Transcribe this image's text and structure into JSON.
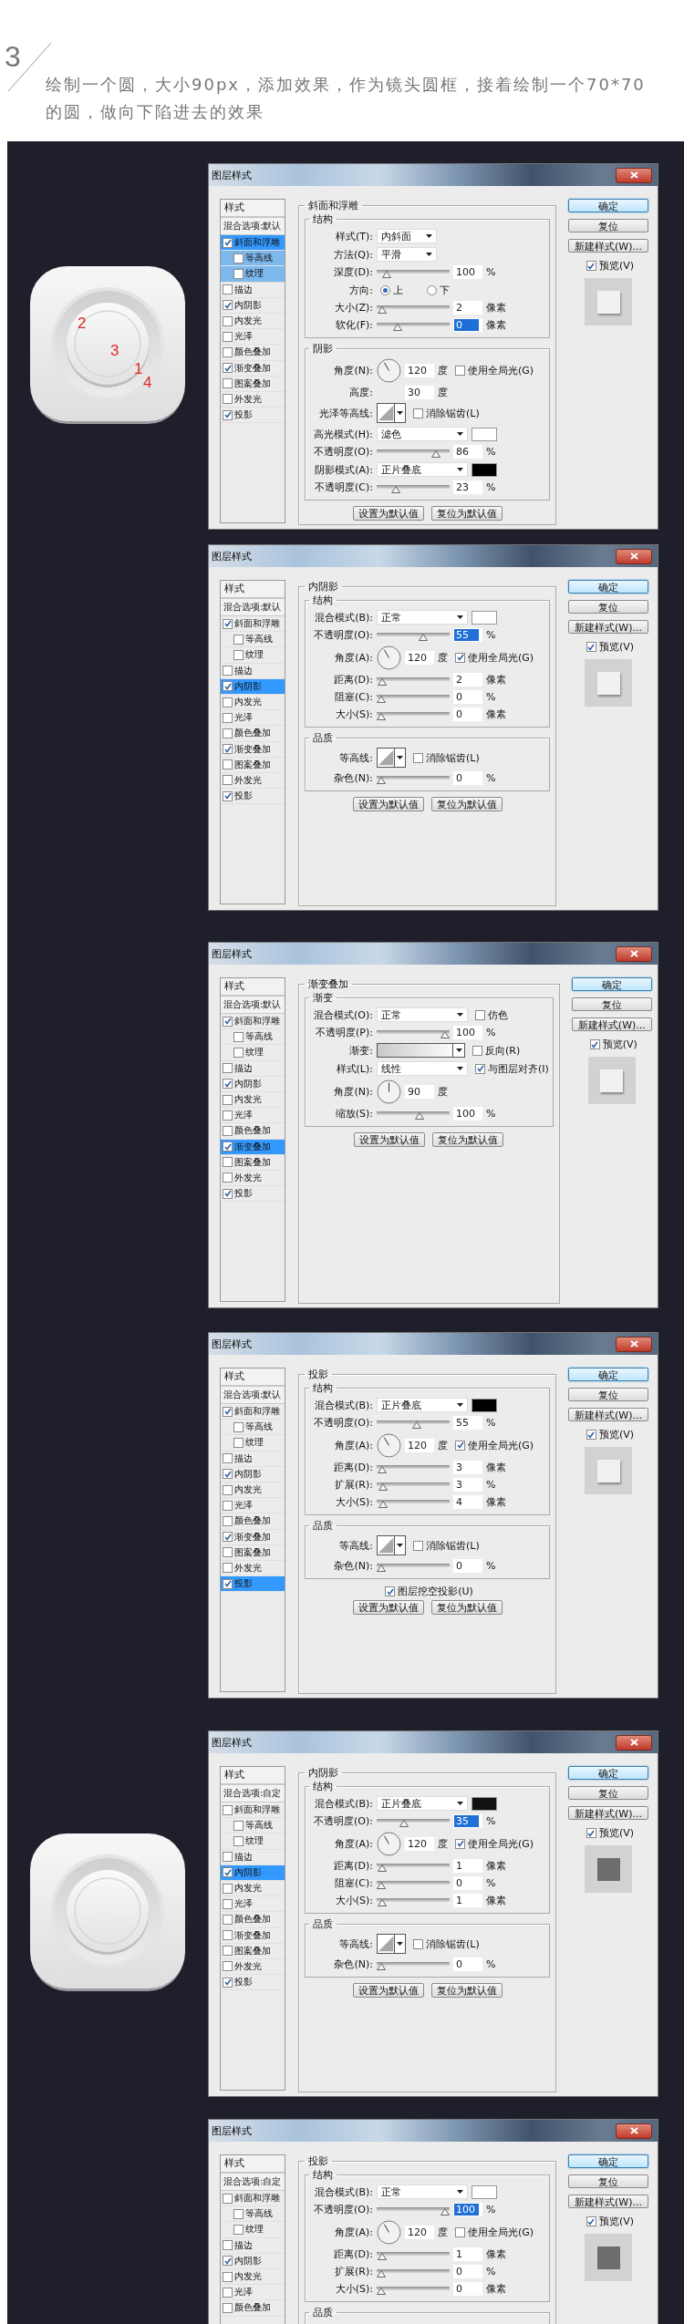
{
  "step": "3",
  "intro": "绘制一个圆，大小90px，添加效果，作为镜头圆框，接着绘制一个70*70的圆，做向下陷进去的效果",
  "dialogs": [
    {
      "title": "图层样式",
      "artwork": {
        "kind": "app-icon",
        "annotations": [
          "2",
          "3",
          "1",
          "4"
        ]
      },
      "styles_header": "样式",
      "blend_options": "混合选项:默认",
      "style_items": [
        {
          "label": "斜面和浮雕",
          "checked": true,
          "selected": true,
          "children": [
            {
              "label": "等高线",
              "checked": false,
              "selected": false
            },
            {
              "label": "纹理",
              "checked": false,
              "selected": false
            }
          ]
        },
        {
          "label": "描边",
          "checked": false,
          "selected": false
        },
        {
          "label": "内阴影",
          "checked": true,
          "selected": false
        },
        {
          "label": "内发光",
          "checked": false,
          "selected": false
        },
        {
          "label": "光泽",
          "checked": false,
          "selected": false
        },
        {
          "label": "颜色叠加",
          "checked": false,
          "selected": false
        },
        {
          "label": "渐变叠加",
          "checked": true,
          "selected": false
        },
        {
          "label": "图案叠加",
          "checked": false,
          "selected": false
        },
        {
          "label": "外发光",
          "checked": false,
          "selected": false
        },
        {
          "label": "投影",
          "checked": true,
          "selected": false
        }
      ],
      "panel_title": "斜面和浮雕",
      "groups": [
        {
          "title": "结构",
          "rows": [
            {
              "kind": "dropdown",
              "label": "样式(T):",
              "value": "内斜面"
            },
            {
              "kind": "dropdown",
              "label": "方法(Q):",
              "value": "平滑"
            },
            {
              "kind": "slider",
              "label": "深度(D):",
              "level": 0.09,
              "value": "100",
              "unit": "%",
              "highlighted": false
            },
            {
              "kind": "radio",
              "label": "方向:",
              "options": [
                {
                  "label": "上",
                  "selected": true
                },
                {
                  "label": "下",
                  "selected": false
                }
              ]
            },
            {
              "kind": "slider",
              "label": "大小(Z):",
              "level": 0.02,
              "value": "2",
              "unit": "像素",
              "highlighted": false
            },
            {
              "kind": "slider",
              "label": "软化(F):",
              "level": 0.26,
              "value": "0",
              "unit": "像素",
              "highlighted": true
            }
          ]
        },
        {
          "title": "阴影",
          "rows": [
            {
              "kind": "angle",
              "label": "角度(N):",
              "value": "120",
              "unit": "度",
              "checkbox": {
                "label": "使用全局光(G)",
                "checked": false
              }
            },
            {
              "kind": "number",
              "label": "高度:",
              "value": "30",
              "unit": "度"
            },
            {
              "kind": "contour",
              "label": "光泽等高线:",
              "checkbox": {
                "label": "消除锯齿(L)",
                "checked": false
              }
            },
            {
              "kind": "dropdown",
              "label": "高光模式(H):",
              "value": "滤色",
              "color": "#ffffff"
            },
            {
              "kind": "slider",
              "label": "不透明度(O):",
              "level": 0.85,
              "value": "86",
              "unit": "%",
              "highlighted": false
            },
            {
              "kind": "dropdown",
              "label": "阴影模式(A):",
              "value": "正片叠底",
              "color": "#000000"
            },
            {
              "kind": "slider",
              "label": "不透明度(C):",
              "level": 0.23,
              "value": "23",
              "unit": "%",
              "highlighted": false
            }
          ]
        }
      ],
      "defaults_buttons": [
        "设置为默认值",
        "复位为默认值"
      ],
      "actions": [
        {
          "label": "确定",
          "default": true
        },
        {
          "label": "复位",
          "default": false
        },
        {
          "label": "新建样式(W)...",
          "default": false
        }
      ],
      "preview": {
        "label": "预览(V)",
        "checked": true,
        "kind": "light"
      }
    },
    {
      "title": "图层样式",
      "styles_header": "样式",
      "blend_options": "混合选项:默认",
      "style_items": [
        {
          "label": "斜面和浮雕",
          "checked": true,
          "selected": false,
          "children": [
            {
              "label": "等高线",
              "checked": false,
              "selected": false
            },
            {
              "label": "纹理",
              "checked": false,
              "selected": false
            }
          ]
        },
        {
          "label": "描边",
          "checked": false,
          "selected": false
        },
        {
          "label": "内阴影",
          "checked": true,
          "selected": true
        },
        {
          "label": "内发光",
          "checked": false,
          "selected": false
        },
        {
          "label": "光泽",
          "checked": false,
          "selected": false
        },
        {
          "label": "颜色叠加",
          "checked": false,
          "selected": false
        },
        {
          "label": "渐变叠加",
          "checked": true,
          "selected": false
        },
        {
          "label": "图案叠加",
          "checked": false,
          "selected": false
        },
        {
          "label": "外发光",
          "checked": false,
          "selected": false
        },
        {
          "label": "投影",
          "checked": true,
          "selected": false
        }
      ],
      "panel_title": "内阴影",
      "groups": [
        {
          "title": "结构",
          "rows": [
            {
              "kind": "dropdown",
              "label": "混合模式(B):",
              "value": "正常",
              "color": "#ffffff"
            },
            {
              "kind": "slider",
              "label": "不透明度(O):",
              "level": 0.66,
              "value": "55",
              "unit": "%",
              "highlighted": true
            },
            {
              "kind": "angle",
              "label": "角度(A):",
              "value": "120",
              "unit": "度",
              "checkbox": {
                "label": "使用全局光(G)",
                "checked": true
              }
            },
            {
              "kind": "slider",
              "label": "距离(D):",
              "level": 0.02,
              "value": "2",
              "unit": "像素",
              "highlighted": false
            },
            {
              "kind": "slider",
              "label": "阻塞(C):",
              "level": 0,
              "value": "0",
              "unit": "%",
              "highlighted": false
            },
            {
              "kind": "slider",
              "label": "大小(S):",
              "level": 0,
              "value": "0",
              "unit": "像素",
              "highlighted": false
            }
          ]
        },
        {
          "title": "品质",
          "rows": [
            {
              "kind": "contour",
              "label": "等高线:",
              "checkbox": {
                "label": "消除锯齿(L)",
                "checked": false
              }
            },
            {
              "kind": "slider",
              "label": "杂色(N):",
              "level": 0,
              "value": "0",
              "unit": "%",
              "highlighted": false
            }
          ]
        }
      ],
      "defaults_buttons": [
        "设置为默认值",
        "复位为默认值"
      ],
      "actions": [
        {
          "label": "确定",
          "default": true
        },
        {
          "label": "复位",
          "default": false
        },
        {
          "label": "新建样式(W)...",
          "default": false
        }
      ],
      "preview": {
        "label": "预览(V)",
        "checked": true,
        "kind": "light"
      }
    },
    {
      "title": "图层样式",
      "styles_header": "样式",
      "blend_options": "混合选项:默认",
      "style_items": [
        {
          "label": "斜面和浮雕",
          "checked": true,
          "selected": false,
          "children": [
            {
              "label": "等高线",
              "checked": false,
              "selected": false
            },
            {
              "label": "纹理",
              "checked": false,
              "selected": false
            }
          ]
        },
        {
          "label": "描边",
          "checked": false,
          "selected": false
        },
        {
          "label": "内阴影",
          "checked": true,
          "selected": false
        },
        {
          "label": "内发光",
          "checked": false,
          "selected": false
        },
        {
          "label": "光泽",
          "checked": false,
          "selected": false
        },
        {
          "label": "颜色叠加",
          "checked": false,
          "selected": false
        },
        {
          "label": "渐变叠加",
          "checked": true,
          "selected": true
        },
        {
          "label": "图案叠加",
          "checked": false,
          "selected": false
        },
        {
          "label": "外发光",
          "checked": false,
          "selected": false
        },
        {
          "label": "投影",
          "checked": true,
          "selected": false
        }
      ],
      "panel_title": "渐变叠加",
      "groups": [
        {
          "title": "渐变",
          "rows": [
            {
              "kind": "dropdown",
              "label": "混合模式(O):",
              "value": "正常",
              "checkbox": {
                "label": "仿色",
                "checked": false
              }
            },
            {
              "kind": "slider",
              "label": "不透明度(P):",
              "level": 1,
              "value": "100",
              "unit": "%",
              "highlighted": false
            },
            {
              "kind": "gradient",
              "label": "渐变:",
              "checkbox": {
                "label": "反向(R)",
                "checked": false
              }
            },
            {
              "kind": "dropdown",
              "label": "样式(L):",
              "value": "线性",
              "checkbox": {
                "label": "与图层对齐(I)",
                "checked": true
              }
            },
            {
              "kind": "angle",
              "label": "角度(N):",
              "value": "90",
              "unit": "度"
            },
            {
              "kind": "slider",
              "label": "缩放(S):",
              "level": 0.6,
              "value": "100",
              "unit": "%",
              "highlighted": false
            }
          ]
        }
      ],
      "defaults_buttons": [
        "设置为默认值",
        "复位为默认值"
      ],
      "actions": [
        {
          "label": "确定",
          "default": true
        },
        {
          "label": "复位",
          "default": false
        },
        {
          "label": "新建样式(W)...",
          "default": false
        }
      ],
      "preview": {
        "label": "预览(V)",
        "checked": true,
        "kind": "light"
      }
    },
    {
      "title": "图层样式",
      "styles_header": "样式",
      "blend_options": "混合选项:默认",
      "style_items": [
        {
          "label": "斜面和浮雕",
          "checked": true,
          "selected": false,
          "children": [
            {
              "label": "等高线",
              "checked": false,
              "selected": false
            },
            {
              "label": "纹理",
              "checked": false,
              "selected": false
            }
          ]
        },
        {
          "label": "描边",
          "checked": false,
          "selected": false
        },
        {
          "label": "内阴影",
          "checked": true,
          "selected": false
        },
        {
          "label": "内发光",
          "checked": false,
          "selected": false
        },
        {
          "label": "光泽",
          "checked": false,
          "selected": false
        },
        {
          "label": "颜色叠加",
          "checked": false,
          "selected": false
        },
        {
          "label": "渐变叠加",
          "checked": true,
          "selected": false
        },
        {
          "label": "图案叠加",
          "checked": false,
          "selected": false
        },
        {
          "label": "外发光",
          "checked": false,
          "selected": false
        },
        {
          "label": "投影",
          "checked": true,
          "selected": true
        }
      ],
      "panel_title": "投影",
      "groups": [
        {
          "title": "结构",
          "rows": [
            {
              "kind": "dropdown",
              "label": "混合模式(B):",
              "value": "正片叠底",
              "color": "#000000"
            },
            {
              "kind": "slider",
              "label": "不透明度(O):",
              "level": 0.55,
              "value": "55",
              "unit": "%",
              "highlighted": false
            },
            {
              "kind": "angle",
              "label": "角度(A):",
              "value": "120",
              "unit": "度",
              "checkbox": {
                "label": "使用全局光(G)",
                "checked": true
              }
            },
            {
              "kind": "slider",
              "label": "距离(D):",
              "level": 0.02,
              "value": "3",
              "unit": "像素",
              "highlighted": false
            },
            {
              "kind": "slider",
              "label": "扩展(R):",
              "level": 0.03,
              "value": "3",
              "unit": "%",
              "highlighted": false
            },
            {
              "kind": "slider",
              "label": "大小(S):",
              "level": 0.03,
              "value": "4",
              "unit": "像素",
              "highlighted": false
            }
          ]
        },
        {
          "title": "品质",
          "rows": [
            {
              "kind": "contour",
              "label": "等高线:",
              "checkbox": {
                "label": "消除锯齿(L)",
                "checked": false
              }
            },
            {
              "kind": "slider",
              "label": "杂色(N):",
              "level": 0,
              "value": "0",
              "unit": "%",
              "highlighted": false
            }
          ]
        }
      ],
      "knockout": {
        "label": "图层挖空投影(U)",
        "checked": true
      },
      "defaults_buttons": [
        "设置为默认值",
        "复位为默认值"
      ],
      "actions": [
        {
          "label": "确定",
          "default": true
        },
        {
          "label": "复位",
          "default": false
        },
        {
          "label": "新建样式(W)...",
          "default": false
        }
      ],
      "preview": {
        "label": "预览(V)",
        "checked": true,
        "kind": "light"
      }
    },
    {
      "title": "图层样式",
      "artwork": {
        "kind": "app-icon"
      },
      "styles_header": "样式",
      "blend_options": "混合选项:自定",
      "style_items": [
        {
          "label": "斜面和浮雕",
          "checked": false,
          "selected": false,
          "children": [
            {
              "label": "等高线",
              "checked": false,
              "selected": false
            },
            {
              "label": "纹理",
              "checked": false,
              "selected": false
            }
          ]
        },
        {
          "label": "描边",
          "checked": false,
          "selected": false
        },
        {
          "label": "内阴影",
          "checked": true,
          "selected": true
        },
        {
          "label": "内发光",
          "checked": false,
          "selected": false
        },
        {
          "label": "光泽",
          "checked": false,
          "selected": false
        },
        {
          "label": "颜色叠加",
          "checked": false,
          "selected": false
        },
        {
          "label": "渐变叠加",
          "checked": false,
          "selected": false
        },
        {
          "label": "图案叠加",
          "checked": false,
          "selected": false
        },
        {
          "label": "外发光",
          "checked": false,
          "selected": false
        },
        {
          "label": "投影",
          "checked": true,
          "selected": false
        }
      ],
      "panel_title": "内阴影",
      "groups": [
        {
          "title": "结构",
          "rows": [
            {
              "kind": "dropdown",
              "label": "混合模式(B):",
              "value": "正片叠底",
              "color": "#111111"
            },
            {
              "kind": "slider",
              "label": "不透明度(O):",
              "level": 0.35,
              "value": "35",
              "unit": "%",
              "highlighted": true
            },
            {
              "kind": "angle",
              "label": "角度(A):",
              "value": "120",
              "unit": "度",
              "checkbox": {
                "label": "使用全局光(G)",
                "checked": true
              }
            },
            {
              "kind": "slider",
              "label": "距离(D):",
              "level": 0.01,
              "value": "1",
              "unit": "像素",
              "highlighted": false
            },
            {
              "kind": "slider",
              "label": "阻塞(C):",
              "level": 0,
              "value": "0",
              "unit": "%",
              "highlighted": false
            },
            {
              "kind": "slider",
              "label": "大小(S):",
              "level": 0.01,
              "value": "1",
              "unit": "像素",
              "highlighted": false
            }
          ]
        },
        {
          "title": "品质",
          "rows": [
            {
              "kind": "contour",
              "label": "等高线:",
              "checkbox": {
                "label": "消除锯齿(L)",
                "checked": false
              }
            },
            {
              "kind": "slider",
              "label": "杂色(N):",
              "level": 0,
              "value": "0",
              "unit": "%",
              "highlighted": false
            }
          ]
        }
      ],
      "defaults_buttons": [
        "设置为默认值",
        "复位为默认值"
      ],
      "actions": [
        {
          "label": "确定",
          "default": true
        },
        {
          "label": "复位",
          "default": false
        },
        {
          "label": "新建样式(W)...",
          "default": false
        }
      ],
      "preview": {
        "label": "预览(V)",
        "checked": true,
        "kind": "dark"
      }
    },
    {
      "title": "图层样式",
      "styles_header": "样式",
      "blend_options": "混合选项:自定",
      "style_items": [
        {
          "label": "斜面和浮雕",
          "checked": false,
          "selected": false,
          "children": [
            {
              "label": "等高线",
              "checked": false,
              "selected": false
            },
            {
              "label": "纹理",
              "checked": false,
              "selected": false
            }
          ]
        },
        {
          "label": "描边",
          "checked": false,
          "selected": false
        },
        {
          "label": "内阴影",
          "checked": true,
          "selected": false
        },
        {
          "label": "内发光",
          "checked": false,
          "selected": false
        },
        {
          "label": "光泽",
          "checked": false,
          "selected": false
        },
        {
          "label": "颜色叠加",
          "checked": false,
          "selected": false
        }
      ],
      "panel_title": "投影",
      "groups": [
        {
          "title": "结构",
          "rows": [
            {
              "kind": "dropdown",
              "label": "混合模式(B):",
              "value": "正常",
              "color": "#ffffff"
            },
            {
              "kind": "slider",
              "label": "不透明度(O):",
              "level": 1,
              "value": "100",
              "unit": "%",
              "highlighted": true
            },
            {
              "kind": "angle",
              "label": "角度(A):",
              "value": "120",
              "unit": "度",
              "checkbox": {
                "label": "使用全局光(G)",
                "checked": false
              }
            },
            {
              "kind": "slider",
              "label": "距离(D):",
              "level": 0.01,
              "value": "1",
              "unit": "像素",
              "highlighted": false
            },
            {
              "kind": "slider",
              "label": "扩展(R):",
              "level": 0,
              "value": "0",
              "unit": "%",
              "highlighted": false
            },
            {
              "kind": "slider",
              "label": "大小(S):",
              "level": 0,
              "value": "0",
              "unit": "像素",
              "highlighted": false
            }
          ]
        },
        {
          "title": "品质"
        }
      ],
      "actions": [
        {
          "label": "确定",
          "default": true
        },
        {
          "label": "复位",
          "default": false
        },
        {
          "label": "新建样式(W)...",
          "default": false
        }
      ],
      "preview": {
        "label": "预览(V)",
        "checked": true,
        "kind": "dark"
      }
    }
  ]
}
